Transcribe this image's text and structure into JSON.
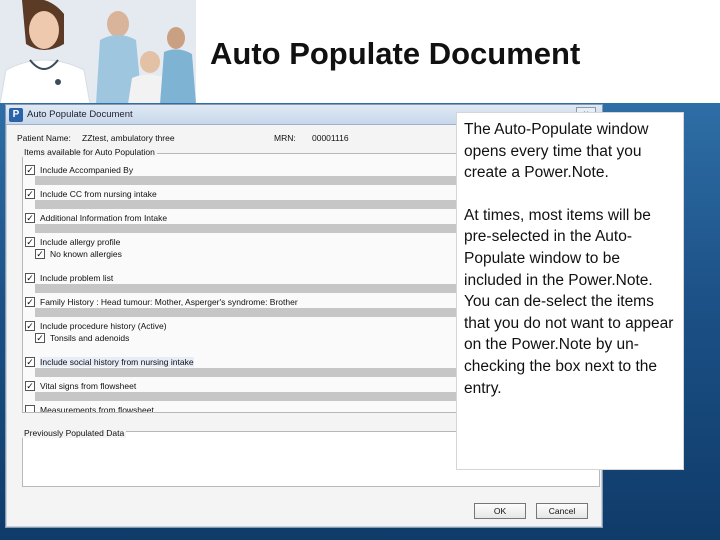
{
  "slide": {
    "title": "Auto Populate Document",
    "colors": {
      "band_top": "#2e6ea6",
      "band_bottom": "#0f3b69"
    }
  },
  "dialog": {
    "app_icon": "P",
    "window_title": "Auto Populate Document",
    "close_glyph": "×",
    "patient_name_label": "Patient Name:",
    "patient_name_value": "ZZtest, ambulatory three",
    "mrn_label": "MRN:",
    "mrn_value": "00001116",
    "items_group_label": "Items available for Auto Population",
    "items": [
      {
        "label": "Include Accompanied By",
        "checked": true
      },
      {
        "label": "Include CC from nursing intake",
        "checked": true
      },
      {
        "label": "Additional Information from Intake",
        "checked": true
      },
      {
        "label": "Include allergy profile",
        "checked": true
      },
      {
        "label": "No known allergies",
        "checked": true
      },
      {
        "label": "Include problem list",
        "checked": true
      },
      {
        "label": "Family History : Head tumour: Mother, Asperger's syndrome: Brother",
        "checked": true
      },
      {
        "label": "Include procedure history (Active)",
        "checked": true
      },
      {
        "label": "Tonsils and adenoids",
        "checked": true
      },
      {
        "label": "Include social history from nursing intake",
        "checked": true
      },
      {
        "label": "Vital signs from flowsheet",
        "checked": true
      },
      {
        "label": "Measurements from flowsheet",
        "checked": false
      }
    ],
    "previously_populated_label": "Previously Populated Data",
    "ok_label": "OK",
    "cancel_label": "Cancel"
  },
  "callout": {
    "paragraph1": "The Auto-Populate window opens every time that you create a Power.Note.",
    "paragraph2": "At times, most items will be pre-selected in the Auto-Populate window to be included in the Power.Note. You can de-select the items that you do not want to appear on the Power.Note by un-checking the box next to the entry."
  }
}
